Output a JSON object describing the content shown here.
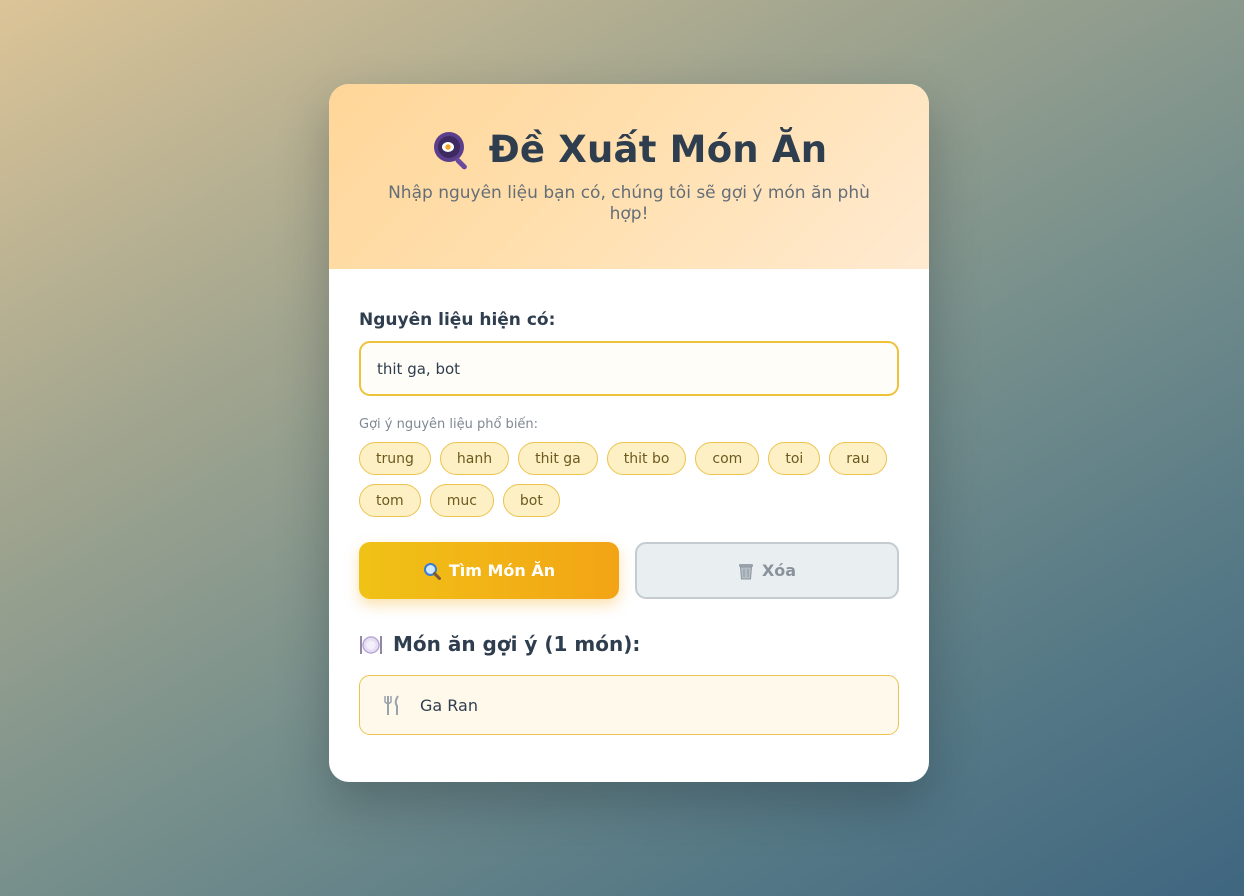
{
  "header": {
    "title": "Đề Xuất Món Ăn",
    "subtitle": "Nhập nguyên liệu bạn có, chúng tôi sẽ gợi ý món ăn phù hợp!",
    "icon": "frying-pan-icon"
  },
  "form": {
    "label": "Nguyên liệu hiện có:",
    "input_value": "thit ga, bot",
    "hint": "Gợi ý nguyên liệu phổ biến:",
    "chips": [
      "trung",
      "hanh",
      "thit ga",
      "thit bo",
      "com",
      "toi",
      "rau",
      "tom",
      "muc",
      "bot"
    ]
  },
  "buttons": {
    "search_label": "Tìm Món Ăn",
    "search_icon": "magnifier-icon",
    "clear_label": "Xóa",
    "clear_icon": "wastebasket-icon"
  },
  "results": {
    "title": "Món ăn gợi ý (1 món):",
    "title_icon": "plate-cutlery-icon",
    "items": [
      {
        "name": "Ga Ran",
        "icon": "fork-knife-icon"
      }
    ]
  },
  "colors": {
    "accent": "#f0c216",
    "accent_dark": "#f3a415",
    "text": "#2f3e4f",
    "chip_bg": "#fdf0c4",
    "chip_border": "#ecc350"
  }
}
